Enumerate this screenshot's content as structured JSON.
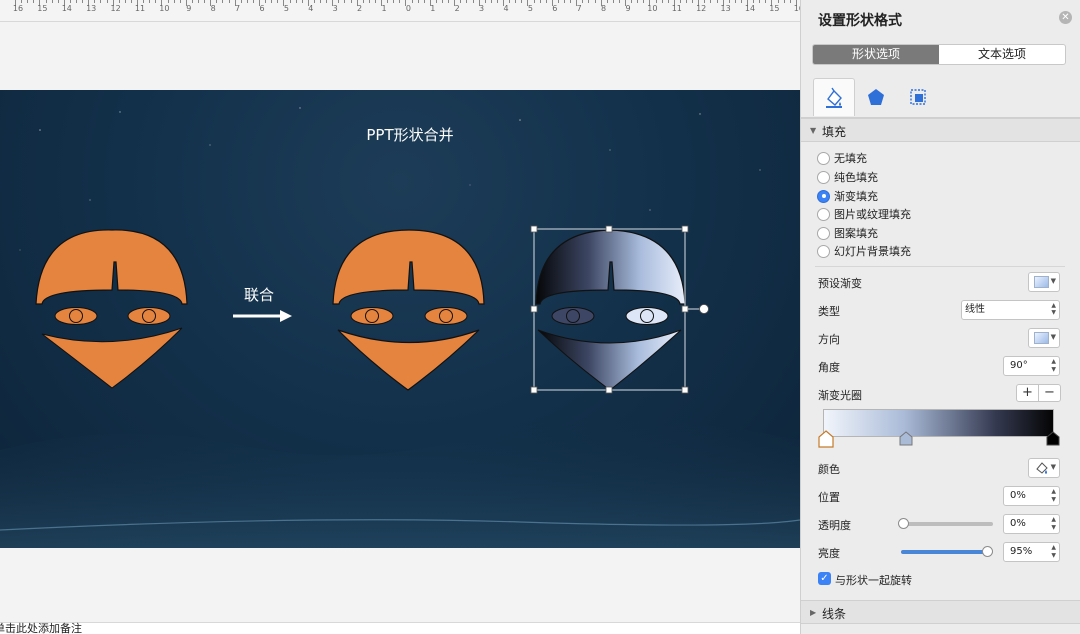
{
  "ruler": {
    "numbers": [
      "16",
      "15",
      "14",
      "13",
      "12",
      "11",
      "10",
      "9",
      "8",
      "7",
      "6",
      "5",
      "4",
      "3",
      "2",
      "1",
      "0",
      "1",
      "2",
      "3",
      "4",
      "5",
      "6",
      "7",
      "8",
      "9",
      "10",
      "11",
      "12",
      "13",
      "14",
      "15",
      "16"
    ]
  },
  "slide": {
    "title": "PPT形状合并",
    "merge_label": "联合"
  },
  "notes": {
    "placeholder": "单击此处添加备注"
  },
  "panel": {
    "title": "设置形状格式",
    "close_icon": "close-icon",
    "tabs": [
      {
        "label": "形状选项",
        "active": true
      },
      {
        "label": "文本选项",
        "active": false
      }
    ],
    "icon_tabs": [
      "fill-line-icon",
      "effects-pentagon-icon",
      "size-properties-icon"
    ],
    "fill_section": {
      "label": "填充",
      "options": [
        {
          "label": "无填充",
          "selected": false
        },
        {
          "label": "纯色填充",
          "selected": false
        },
        {
          "label": "渐变填充",
          "selected": true
        },
        {
          "label": "图片或纹理填充",
          "selected": false
        },
        {
          "label": "图案填充",
          "selected": false
        },
        {
          "label": "幻灯片背景填充",
          "selected": false
        }
      ],
      "preset_label": "预设渐变",
      "type_label": "类型",
      "type_value": "线性",
      "direction_label": "方向",
      "angle_label": "角度",
      "angle_value": "90°",
      "stops_label": "渐变光圈",
      "add_stop": "+",
      "remove_stop": "−",
      "gradient_colors": [
        "#f1f5fb",
        "#aabbd8",
        "#343950",
        "#050505"
      ],
      "color_label": "颜色",
      "position_label": "位置",
      "position_value": "0%",
      "transparency_label": "透明度",
      "transparency_value": "0%",
      "transparency_level": 0,
      "brightness_label": "亮度",
      "brightness_value": "95%",
      "brightness_level": 0.95,
      "rotate_with_shape_label": "与形状一起旋转",
      "rotate_with_shape": true
    },
    "line_section": {
      "label": "线条"
    }
  },
  "colors": {
    "orange": "#e5843f",
    "accent": "#3b82f6",
    "slide_bg": "#13314b"
  }
}
